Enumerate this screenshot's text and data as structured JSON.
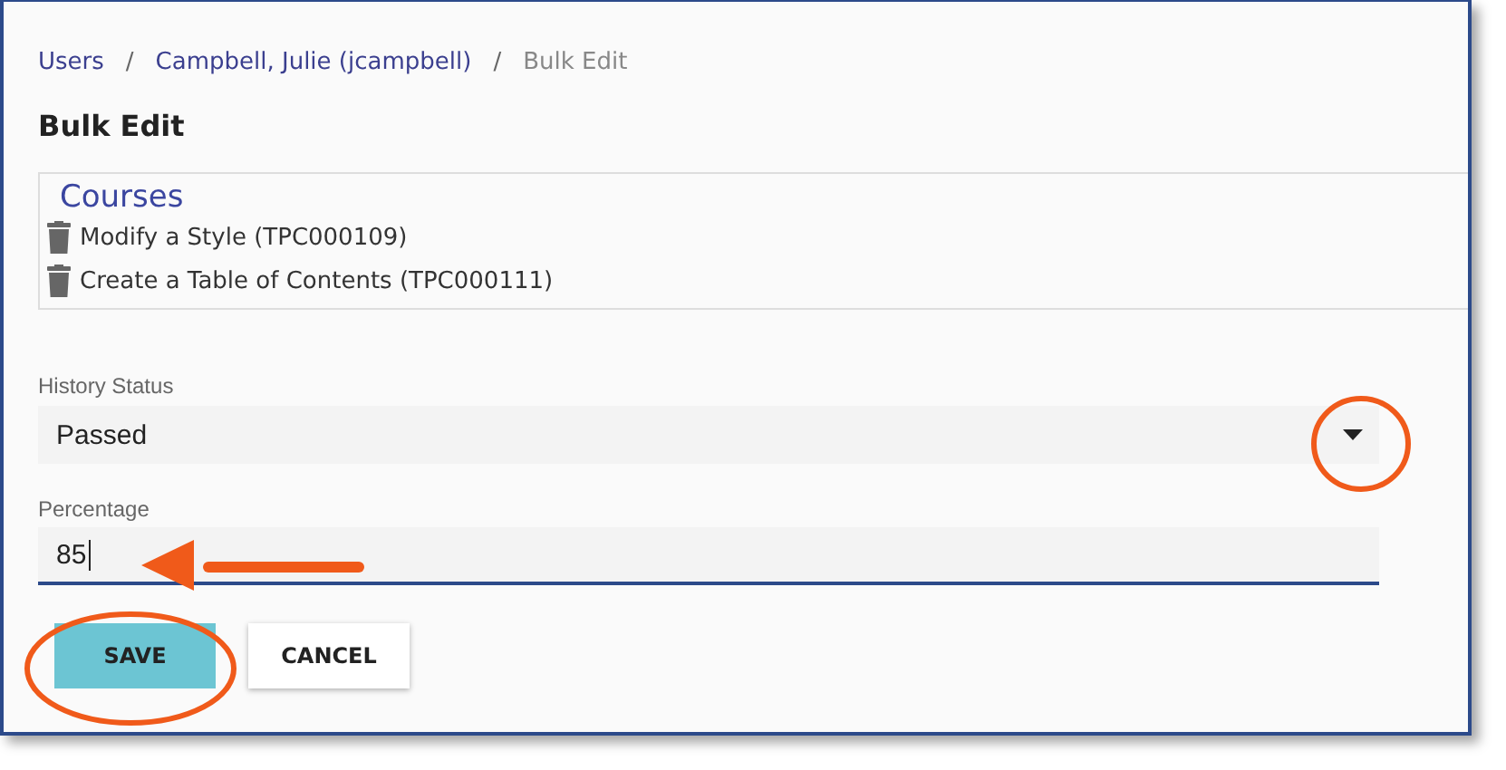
{
  "breadcrumb": [
    {
      "label": "Users",
      "current": false
    },
    {
      "label": "Campbell, Julie (jcampbell)",
      "current": false
    },
    {
      "label": "Bulk Edit",
      "current": true
    }
  ],
  "breadcrumb_separator": "/",
  "title": "Bulk Edit",
  "courses": {
    "heading": "Courses",
    "items": [
      "Modify a Style (TPC000109)",
      "Create a Table of Contents (TPC000111)"
    ]
  },
  "history_status": {
    "label": "History Status",
    "value": "Passed"
  },
  "percentage": {
    "label": "Percentage",
    "value": "85"
  },
  "buttons": [
    {
      "label": "SAVE",
      "kind": "primary"
    },
    {
      "label": "CANCEL",
      "kind": "secondary"
    }
  ]
}
